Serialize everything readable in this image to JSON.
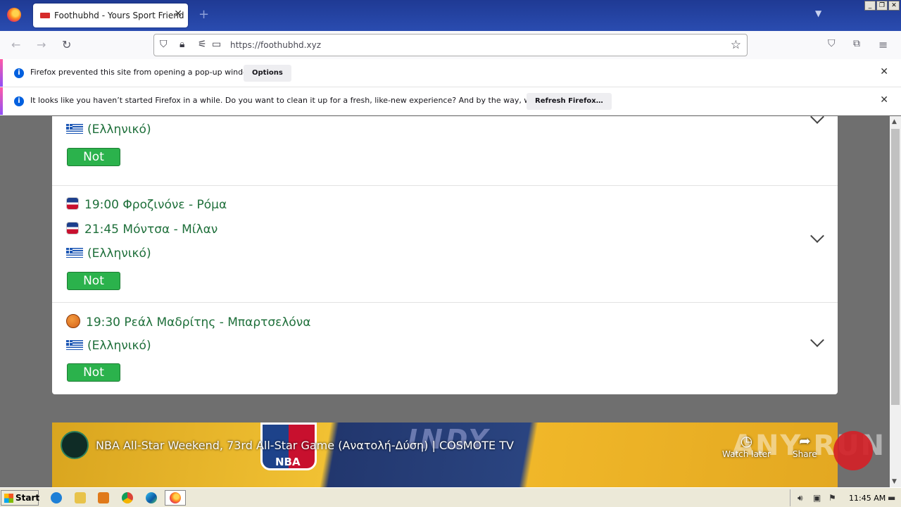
{
  "browser": {
    "tab_title": "Foothubhd - Yours Sport Friend",
    "tab_close": "✕",
    "new_tab": "+",
    "url": "https://foothubhd.xyz",
    "window_buttons": [
      "_",
      "❐",
      "✕"
    ]
  },
  "notifications": [
    {
      "text": "Firefox prevented this site from opening a pop-up window.",
      "button": "Options"
    },
    {
      "text": "It looks like you haven’t started Firefox in a while. Do you want to clean it up for a fresh, like-new experience? And by the way, welcome back!",
      "button": "Refresh Firefox…"
    }
  ],
  "matches": [
    {
      "lines": [
        "(Ελληνικό)"
      ],
      "button": "Not"
    },
    {
      "lines": [
        "19:00 Φροζινόνε - Ρόμα",
        "21:45 Μόντσα - Μίλαν",
        "(Ελληνικό)"
      ],
      "button": "Not"
    },
    {
      "lines": [
        "19:30 Ρεάλ Μαδρίτης - Μπαρτσελόνα",
        "(Ελληνικό)"
      ],
      "button": "Not"
    }
  ],
  "video": {
    "title": "NBA All-Star Weekend, 73rd All-Star Game (Ανατολή-Δύση) | COSMOTE TV",
    "watch_later": "Watch later",
    "share": "Share",
    "banner_text": "INDY",
    "nba_logo_text": "NBA"
  },
  "overlay": {
    "watermark": "ANY RUN"
  },
  "taskbar": {
    "start": "Start",
    "clock": "11:45 AM"
  },
  "colors": {
    "link_green": "#1e6f3a",
    "button_green": "#2bb24c",
    "tab_bar": "#1f3a94"
  }
}
